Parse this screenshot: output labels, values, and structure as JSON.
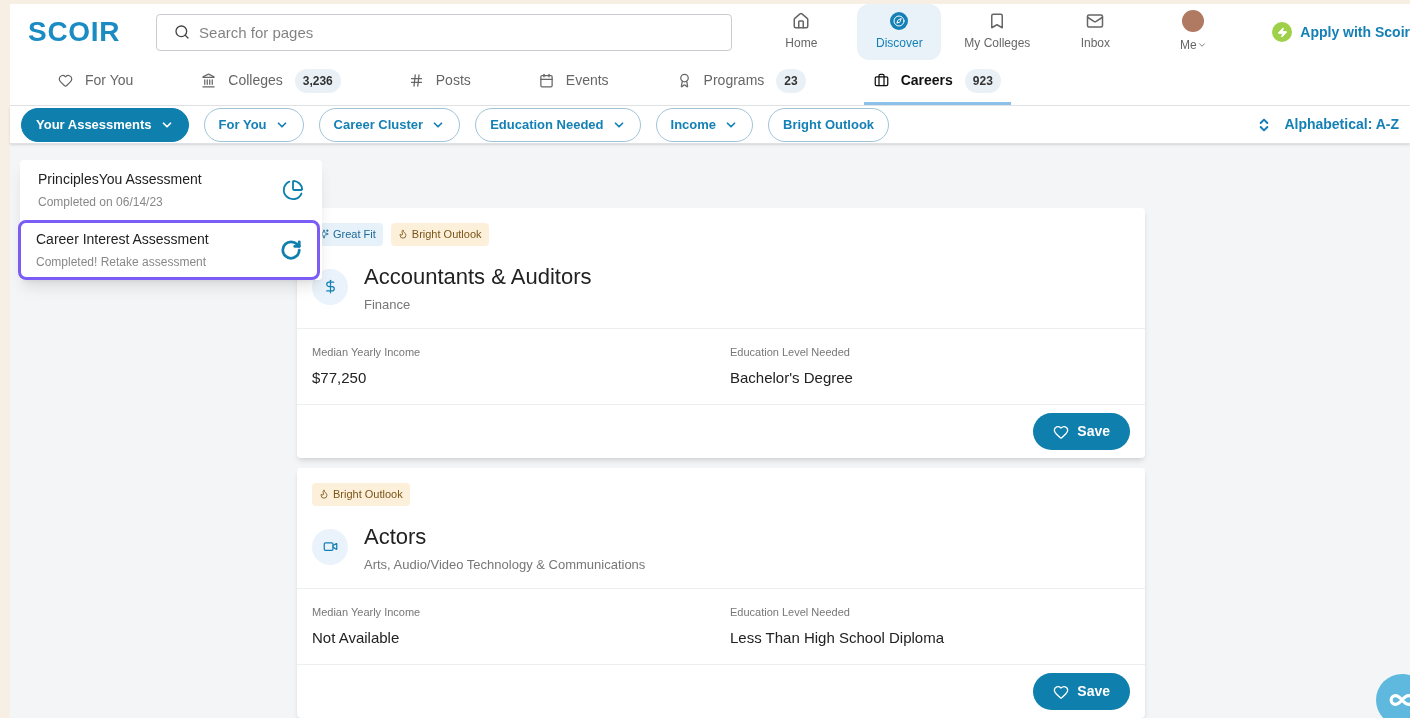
{
  "header": {
    "logo": "SCOIR",
    "search": {
      "placeholder": "Search for pages"
    },
    "nav": [
      {
        "label": "Home",
        "selected": false
      },
      {
        "label": "Discover",
        "selected": true
      },
      {
        "label": "My Colleges",
        "selected": false
      },
      {
        "label": "Inbox",
        "selected": false
      },
      {
        "label": "Me",
        "selected": false
      }
    ],
    "apply": "Apply with Scoir"
  },
  "tabs": [
    {
      "label": "For You",
      "selected": false
    },
    {
      "label": "Colleges",
      "count": "3,236",
      "selected": false
    },
    {
      "label": "Posts",
      "selected": false
    },
    {
      "label": "Events",
      "selected": false
    },
    {
      "label": "Programs",
      "count": "23",
      "selected": false
    },
    {
      "label": "Careers",
      "count": "923",
      "selected": true
    }
  ],
  "filters": [
    {
      "label": "Your Assessments",
      "dropdown": true,
      "selected": true
    },
    {
      "label": "For You",
      "dropdown": true,
      "selected": false
    },
    {
      "label": "Career Cluster",
      "dropdown": true,
      "selected": false
    },
    {
      "label": "Education Needed",
      "dropdown": true,
      "selected": false
    },
    {
      "label": "Income",
      "dropdown": true,
      "selected": false
    },
    {
      "label": "Bright Outlook",
      "dropdown": false,
      "selected": false
    }
  ],
  "sort": "Alphabetical: A-Z",
  "menu": [
    {
      "title": "PrinciplesYou Assessment",
      "subtitle": "Completed on 06/14/23",
      "highlighted": false
    },
    {
      "title": "Career Interest Assessment",
      "subtitle": "Completed! Retake assessment",
      "highlighted": true
    }
  ],
  "careers": [
    {
      "tags": [
        {
          "label": "Great Fit",
          "kind": "fit"
        },
        {
          "label": "Bright Outlook",
          "kind": "outlook"
        }
      ],
      "title": "Accountants & Auditors",
      "cluster": "Finance",
      "income_label": "Median Yearly Income",
      "income": "$77,250",
      "education_label": "Education Level Needed",
      "education": "Bachelor's Degree",
      "save": "Save"
    },
    {
      "tags": [
        {
          "label": "Bright Outlook",
          "kind": "outlook"
        }
      ],
      "title": "Actors",
      "cluster": "Arts, Audio/Video Technology & Communications",
      "income_label": "Median Yearly Income",
      "income": "Not Available",
      "education_label": "Education Level Needed",
      "education": "Less Than High School Diploma",
      "save": "Save"
    }
  ]
}
